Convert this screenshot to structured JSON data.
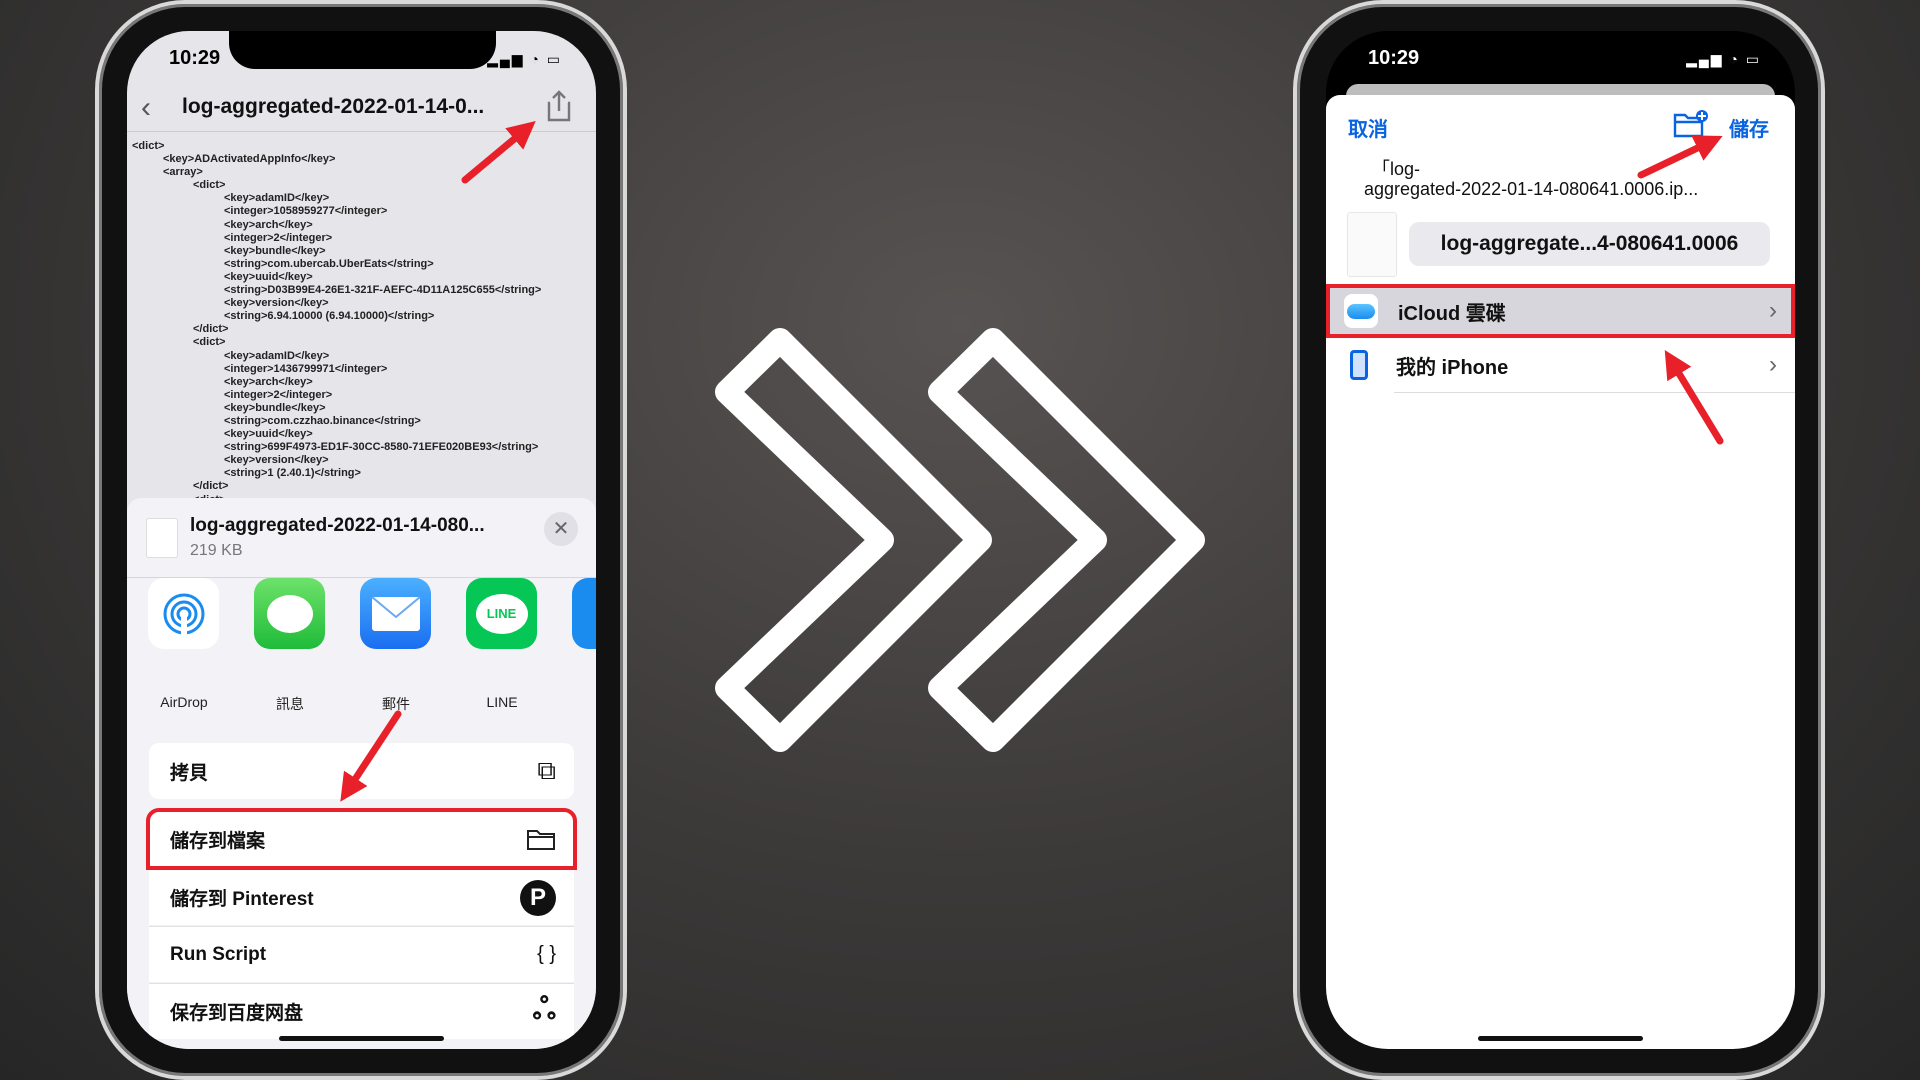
{
  "left_phone": {
    "status_time": "10:29",
    "nav_title": "log-aggregated-2022-01-14-0...",
    "xml_lines": [
      [
        0,
        "<dict>"
      ],
      [
        1,
        "<key>ADActivatedAppInfo</key>"
      ],
      [
        1,
        "<array>"
      ],
      [
        2,
        "<dict>"
      ],
      [
        3,
        "<key>adamID</key>"
      ],
      [
        3,
        "<integer>1058959277</integer>"
      ],
      [
        3,
        "<key>arch</key>"
      ],
      [
        3,
        "<integer>2</integer>"
      ],
      [
        3,
        "<key>bundle</key>"
      ],
      [
        3,
        "<string>com.ubercab.UberEats</string>"
      ],
      [
        3,
        "<key>uuid</key>"
      ],
      [
        3,
        "<string>D03B99E4-26E1-321F-AEFC-4D11A125C655</string>"
      ],
      [
        3,
        "<key>version</key>"
      ],
      [
        3,
        "<string>6.94.10000 (6.94.10000)</string>"
      ],
      [
        2,
        "</dict>"
      ],
      [
        2,
        "<dict>"
      ],
      [
        3,
        "<key>adamID</key>"
      ],
      [
        3,
        "<integer>1436799971</integer>"
      ],
      [
        3,
        "<key>arch</key>"
      ],
      [
        3,
        "<integer>2</integer>"
      ],
      [
        3,
        "<key>bundle</key>"
      ],
      [
        3,
        "<string>com.czzhao.binance</string>"
      ],
      [
        3,
        "<key>uuid</key>"
      ],
      [
        3,
        "<string>699F4973-ED1F-30CC-8580-71EFE020BE93</string>"
      ],
      [
        3,
        "<key>version</key>"
      ],
      [
        3,
        "<string>1 (2.40.1)</string>"
      ],
      [
        2,
        "</dict>"
      ],
      [
        2,
        "<dict>"
      ]
    ],
    "share": {
      "file_name": "log-aggregated-2022-01-14-080...",
      "file_size": "219 KB",
      "apps": [
        {
          "label": "AirDrop",
          "icon": "airdrop-icon"
        },
        {
          "label": "訊息",
          "icon": "messages-icon"
        },
        {
          "label": "郵件",
          "icon": "mail-icon"
        },
        {
          "label": "LINE",
          "icon": "line-icon",
          "icon_text": "LINE"
        }
      ],
      "actions": [
        {
          "label": "拷貝",
          "icon": "copy-icon",
          "glyph": "⧉"
        },
        {
          "label": "儲存到檔案",
          "icon": "folder-icon",
          "glyph": "🗀",
          "highlighted": true
        },
        {
          "label": "儲存到 Pinterest",
          "icon": "pinterest-icon",
          "glyph": "P"
        },
        {
          "label": "Run Script",
          "icon": "braces-icon",
          "glyph": "{ }"
        },
        {
          "label": "保存到百度网盘",
          "icon": "baidu-netdisk-icon",
          "glyph": "ஃ"
        }
      ]
    }
  },
  "right_phone": {
    "status_time": "10:29",
    "cancel": "取消",
    "save": "儲存",
    "file_line1": "「log-",
    "file_line2": "aggregated-2022-01-14-080641.0006.ip...",
    "name_field": "log-aggregate...4-080641.0006",
    "locations": [
      {
        "label": "iCloud 雲碟",
        "icon": "icloud-icon",
        "highlighted": true
      },
      {
        "label": "我的 iPhone",
        "icon": "iphone-icon"
      }
    ]
  },
  "colors": {
    "accent": "#0a63e0",
    "highlight": "#e8202a",
    "arrow": "#e8202a"
  }
}
